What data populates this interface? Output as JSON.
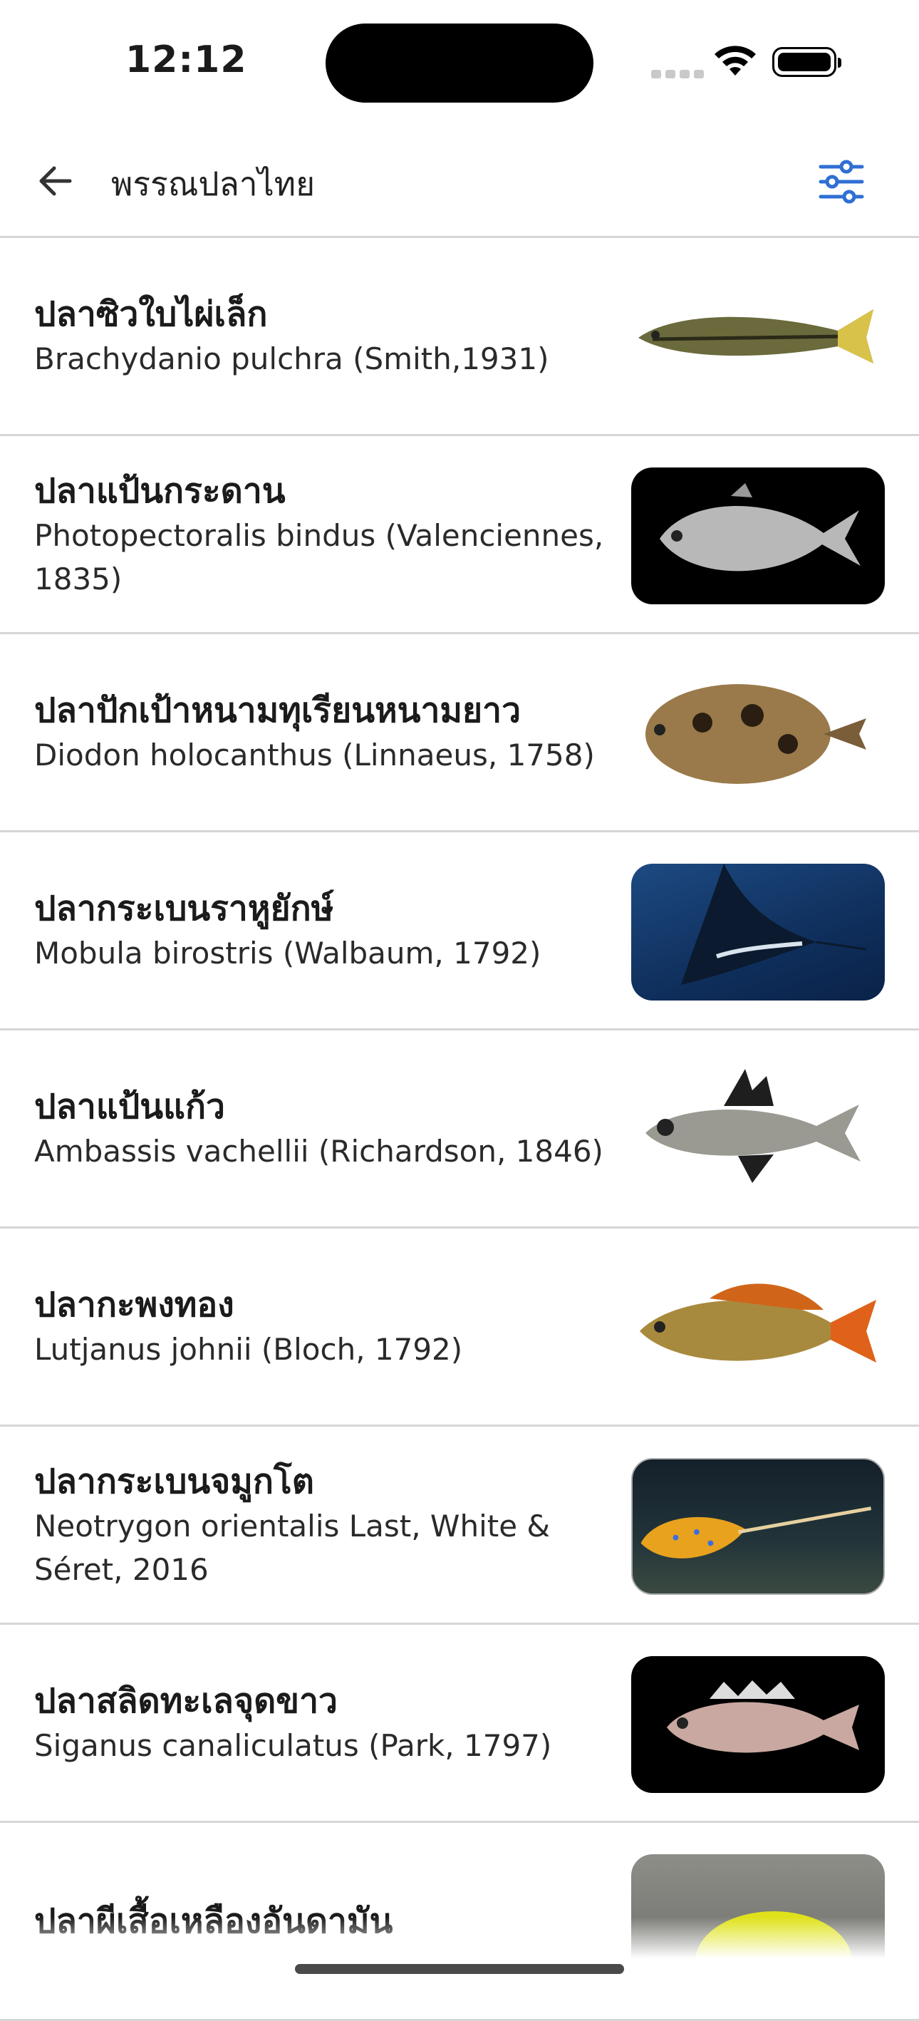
{
  "status_bar": {
    "time": "12:12"
  },
  "app_bar": {
    "title": "พรรณปลาไทย",
    "back_icon": "arrow-left-icon",
    "filter_icon": "sliders-icon",
    "accent": "#2f6fd4"
  },
  "fish": [
    {
      "thai": "ปลาซิวใบไผ่เล็ก",
      "scientific": "Brachydanio pulchra (Smith,1931)"
    },
    {
      "thai": "ปลาแป้นกระดาน",
      "scientific": "Photopectoralis bindus (Valenciennes, 1835)"
    },
    {
      "thai": "ปลาปักเป้าหนามทุเรียนหนามยาว",
      "scientific": "Diodon holocanthus (Linnaeus, 1758)"
    },
    {
      "thai": "ปลากระเบนราหูยักษ์",
      "scientific": "Mobula birostris (Walbaum, 1792)"
    },
    {
      "thai": "ปลาแป้นแก้ว",
      "scientific": "Ambassis vachellii (Richardson, 1846)"
    },
    {
      "thai": "ปลากะพงทอง",
      "scientific": "Lutjanus johnii (Bloch, 1792)"
    },
    {
      "thai": "ปลากระเบนจมูกโต",
      "scientific": "Neotrygon orientalis Last, White & Séret, 2016"
    },
    {
      "thai": "ปลาสลิดทะเลจุดขาว",
      "scientific": "Siganus canaliculatus (Park, 1797)"
    },
    {
      "thai": "ปลาผีเสื้อเหลืองอันดามัน",
      "scientific": ""
    }
  ]
}
